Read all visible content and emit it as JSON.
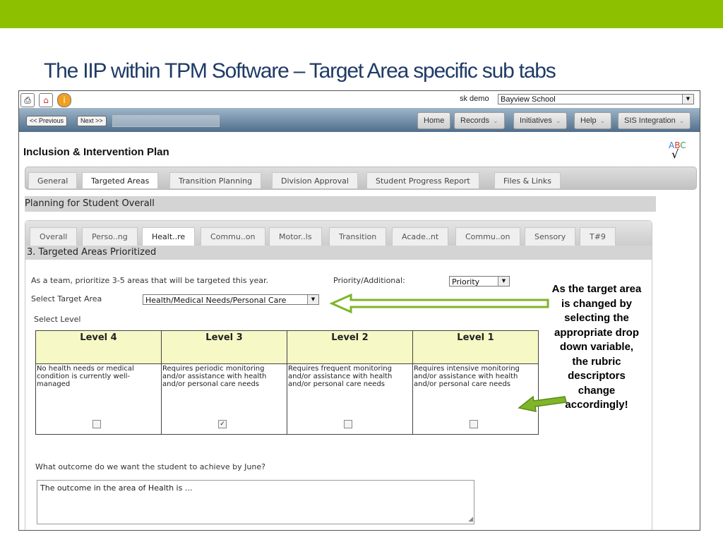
{
  "slide": {
    "title": "The IIP within TPM Software – Target Area specific sub tabs"
  },
  "accent_color": "#8dc100",
  "app": {
    "user": "sk demo",
    "school": "Bayview School",
    "nav": {
      "previous": "<< Previous",
      "next": "Next >>",
      "menu": [
        "Home",
        "Records",
        "Initiatives",
        "Help",
        "SIS Integration"
      ]
    },
    "page_title": "Inclusion & Intervention Plan",
    "main_tabs": [
      "General",
      "Targeted Areas",
      "Transition Planning",
      "Division Approval",
      "Student Progress Report",
      "Files & Links"
    ],
    "active_main_tab": "Targeted Areas",
    "section_title": "Planning for Student Overall",
    "sub_tabs": [
      "Overall",
      "Perso..ng",
      "Healt..re",
      "Commu..on",
      "Motor..ls",
      "Transition",
      "Acade..nt",
      "Commu..on",
      "Sensory",
      "T#9"
    ],
    "active_sub_tab": "Healt..re",
    "sub_title": "3. Targeted Areas Prioritized",
    "prioritize_text": "As a team, prioritize 3-5 areas that will be targeted this year.",
    "priority_label": "Priority/Additional:",
    "priority_value": "Priority",
    "target_area_label": "Select Target Area",
    "target_area_value": "Health/Medical Needs/Personal Care",
    "select_level_label": "Select Level",
    "levels": [
      {
        "header": "Level 4",
        "description": "No health needs or medical condition is currently well-managed",
        "checked": false
      },
      {
        "header": "Level 3",
        "description": "Requires periodic monitoring and/or assistance with health and/or personal care needs",
        "checked": true
      },
      {
        "header": "Level 2",
        "description": "Requires frequent monitoring and/or assistance with health and/or personal care needs",
        "checked": false
      },
      {
        "header": "Level 1",
        "description": "Requires intensive monitoring and/or assistance with health and/or personal care needs",
        "checked": false
      }
    ],
    "outcome_question": "What outcome do we want the student to achieve by June?",
    "outcome_value": "The outcome in the area of Health is ..."
  },
  "callout": {
    "text": "As the target area is changed by selecting the appropriate drop down variable, the rubric descriptors change accordingly!",
    "arrow_color": "#7fb528"
  }
}
